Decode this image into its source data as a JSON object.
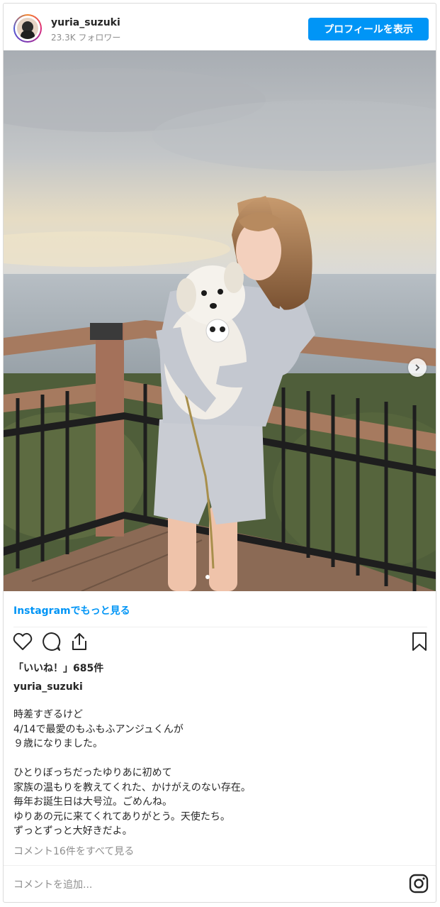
{
  "header": {
    "username": "yuria_suzuki",
    "followers": "23.3K フォロワー",
    "profile_button": "プロフィールを表示"
  },
  "post": {
    "more_link": "Instagramでもっと見る",
    "likes": "「いいね！」685件",
    "caption_username": "yuria_suzuki",
    "caption_lines": [
      "時差すぎるけど",
      "4/14で最愛のもふもふアンジュくんが",
      "９歳になりました。",
      "",
      "ひとりぼっちだったゆりあに初めて",
      "家族の温もりを教えてくれた、かけがえのない存在。",
      "毎年お誕生日は大号泣。ごめんね。",
      "ゆりあの元に来てくれてありがとう。天使たち。",
      "ずっとずっと大好きだよ。"
    ],
    "view_comments": "コメント16件をすべて見る",
    "comment_placeholder": "コメントを追加..."
  },
  "icons": {
    "like": "heart-icon",
    "comment": "comment-icon",
    "share": "share-icon",
    "save": "bookmark-icon",
    "next": "chevron-right-icon",
    "brand": "instagram-icon"
  },
  "colors": {
    "accent": "#0095f6",
    "text": "#262626",
    "muted": "#8e8e8e"
  }
}
